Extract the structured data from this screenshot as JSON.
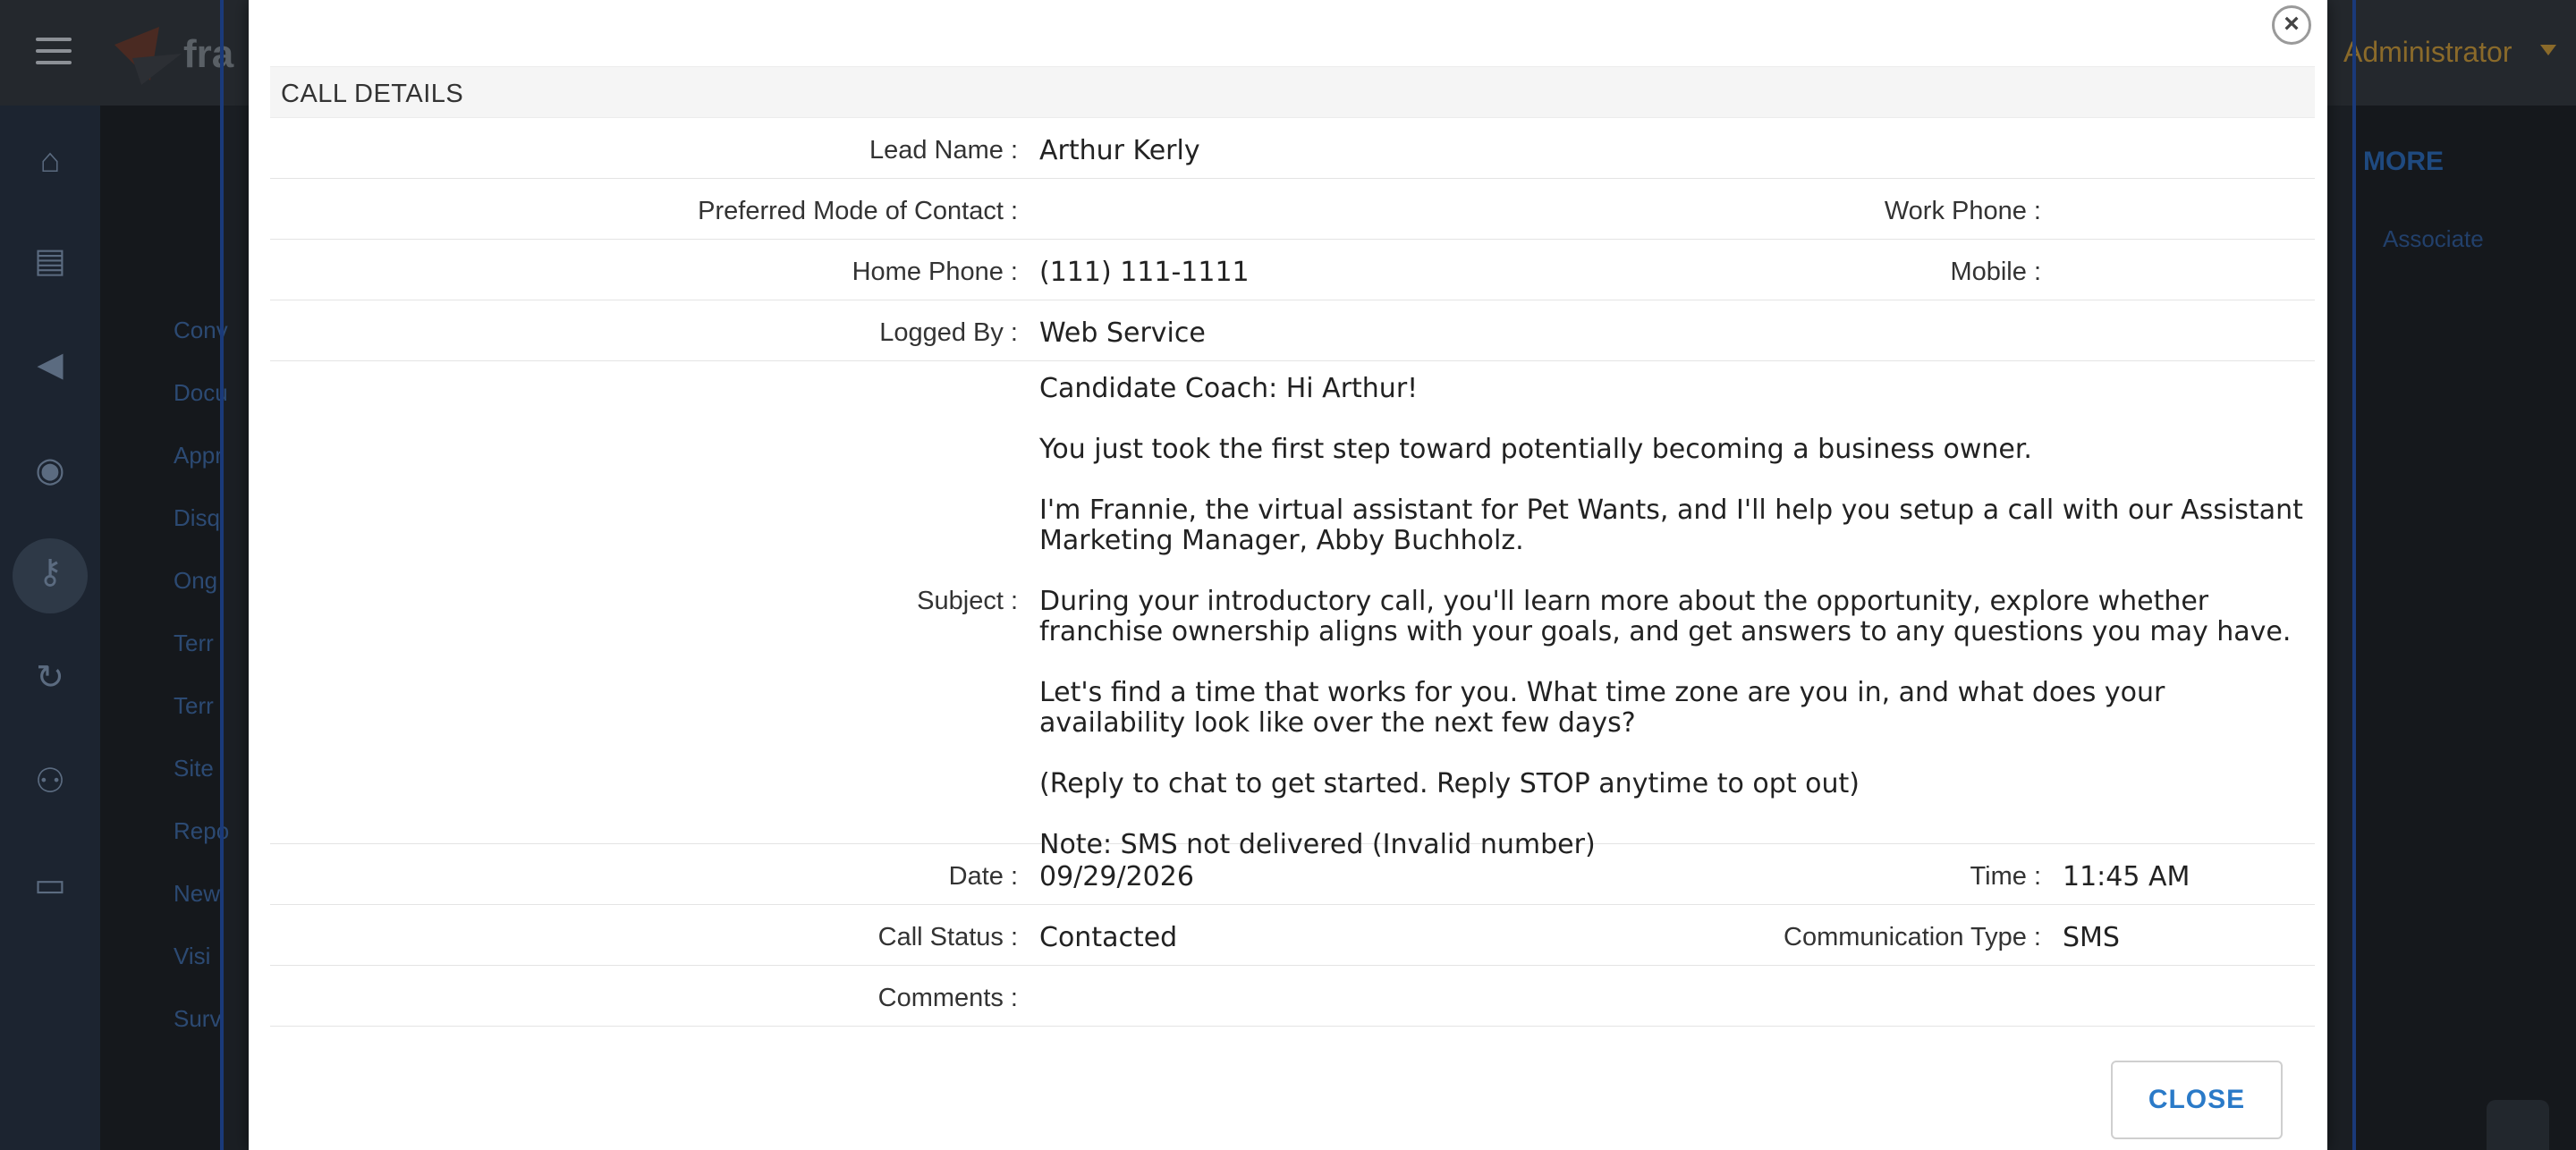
{
  "background": {
    "logo_text": "fra",
    "user_menu": "Administrator",
    "more_label": "MORE",
    "associate_label": "Associate",
    "left_links": [
      "Conv",
      "Docu",
      "Appr",
      "Disq",
      "Ong",
      "Terr",
      "Terr",
      "Site",
      "Repo",
      "New",
      "Visi",
      "Surv"
    ]
  },
  "modal": {
    "section_title": "CALL DETAILS",
    "close_button_label": "CLOSE",
    "fields": {
      "lead_name": {
        "label": "Lead Name :",
        "value": "Arthur Kerly"
      },
      "preferred_mode": {
        "label": "Preferred Mode of Contact :",
        "value": ""
      },
      "work_phone": {
        "label": "Work Phone :",
        "value": ""
      },
      "home_phone": {
        "label": "Home Phone :",
        "value": "(111) 111-1111"
      },
      "mobile": {
        "label": "Mobile :",
        "value": ""
      },
      "logged_by": {
        "label": "Logged By :",
        "value": "Web Service"
      },
      "subject": {
        "label": "Subject :",
        "paragraphs": [
          "Candidate Coach: Hi Arthur!",
          "You just took the first step toward potentially becoming a business owner.",
          "I'm Frannie, the virtual assistant for Pet Wants, and I'll help you setup a call with our Assistant Marketing Manager, Abby Buchholz.",
          "During your introductory call, you'll learn more about the opportunity, explore whether franchise ownership aligns with your goals, and get answers to any questions you may have.",
          "Let's find a time that works for you. What time zone are you in, and what does your availability look like over the next few days?",
          "(Reply to chat to get started. Reply STOP anytime to opt out)",
          "Note: SMS not delivered (Invalid number)"
        ]
      },
      "date": {
        "label": "Date :",
        "value": "09/29/2026"
      },
      "time": {
        "label": "Time :",
        "value": "11:45 AM"
      },
      "call_status": {
        "label": "Call Status :",
        "value": "Contacted"
      },
      "communication_type": {
        "label": "Communication Type :",
        "value": "SMS"
      },
      "comments": {
        "label": "Comments :",
        "value": ""
      }
    }
  }
}
